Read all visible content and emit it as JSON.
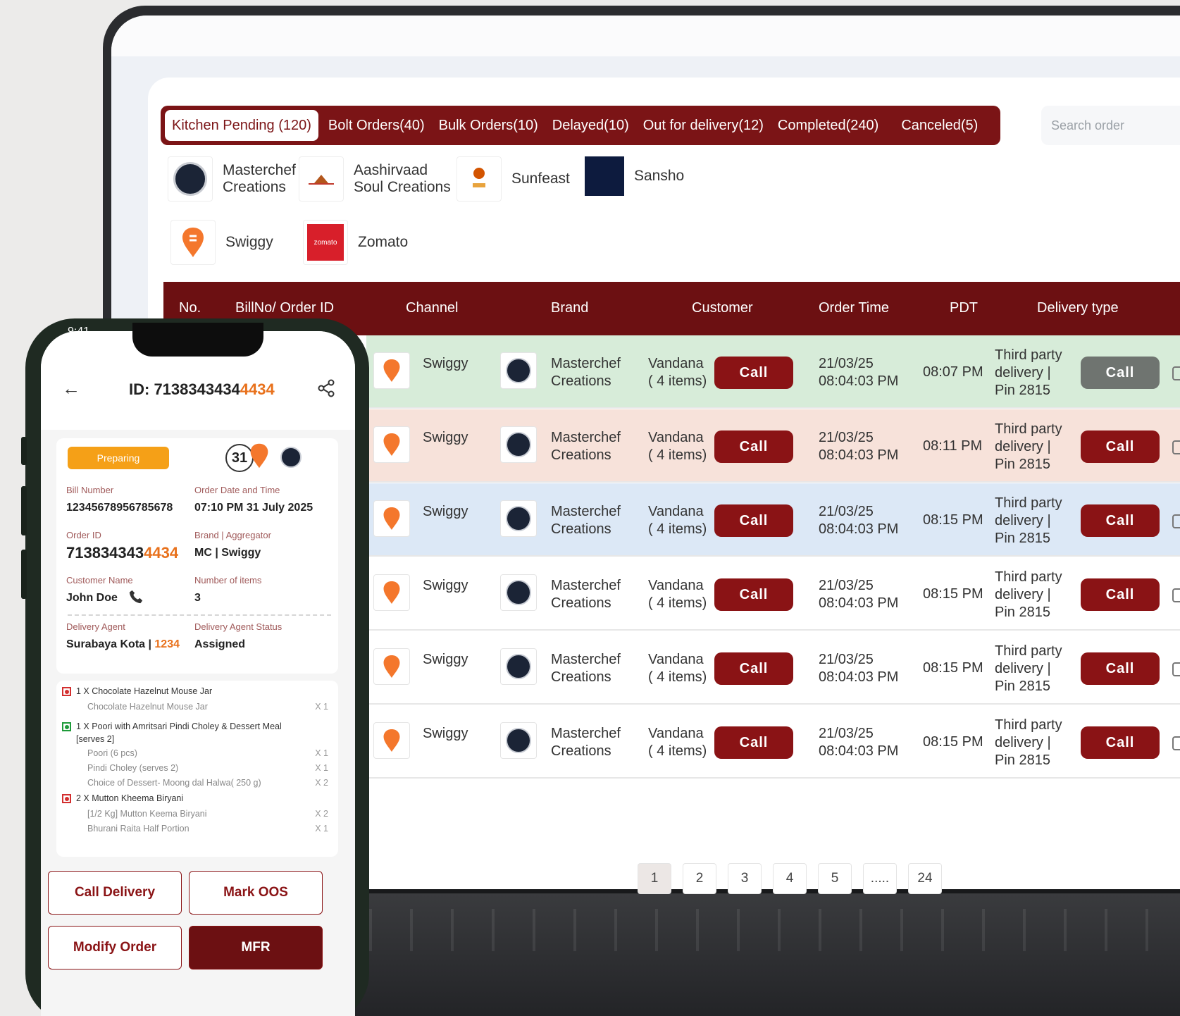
{
  "desktop": {
    "tabs": [
      {
        "label": "Kitchen Pending (120)",
        "active": true
      },
      {
        "label": "Bolt Orders(40)"
      },
      {
        "label": "Bulk Orders(10)"
      },
      {
        "label": "Delayed(10)"
      },
      {
        "label": "Out for delivery(12)"
      },
      {
        "label": "Completed(240)"
      },
      {
        "label": "Canceled(5)"
      }
    ],
    "search_placeholder": "Search order",
    "brand_filters": [
      {
        "line1": "Masterchef",
        "line2": "Creations"
      },
      {
        "line1": "Aashirvaad",
        "line2": "Soul Creations"
      },
      {
        "line1": "Sunfeast",
        "line2": ""
      },
      {
        "line1": "Sansho",
        "line2": ""
      }
    ],
    "channel_filters": [
      "Swiggy",
      "Zomato"
    ],
    "zomato_logo_text": "zomato",
    "columns": [
      "No.",
      "BillNo/ Order ID",
      "Channel",
      "Brand",
      "Customer",
      "Order Time",
      "PDT",
      "Delivery type"
    ],
    "rows": [
      {
        "channel": "Swiggy",
        "brand1": "Masterchef",
        "brand2": "Creations",
        "cust1": "Vandana",
        "cust2": "( 4 items)",
        "call": "Call",
        "date": "21/03/25",
        "time": "08:04:03 PM",
        "pdt": "08:07 PM",
        "del1": "Third party",
        "del2": "delivery |",
        "del3": "Pin 2815",
        "call2": "Call",
        "bg": "#d7ecd9",
        "call2_grey": true
      },
      {
        "channel": "Swiggy",
        "brand1": "Masterchef",
        "brand2": "Creations",
        "cust1": "Vandana",
        "cust2": "( 4 items)",
        "call": "Call",
        "date": "21/03/25",
        "time": "08:04:03 PM",
        "pdt": "08:11 PM",
        "del1": "Third party",
        "del2": "delivery |",
        "del3": "Pin 2815",
        "call2": "Call",
        "bg": "#f7e2da",
        "call2_grey": false
      },
      {
        "channel": "Swiggy",
        "brand1": "Masterchef",
        "brand2": "Creations",
        "cust1": "Vandana",
        "cust2": "( 4 items)",
        "call": "Call",
        "date": "21/03/25",
        "time": "08:04:03 PM",
        "pdt": "08:15 PM",
        "del1": "Third party",
        "del2": "delivery |",
        "del3": "Pin 2815",
        "call2": "Call",
        "bg": "#dce8f6",
        "call2_grey": false
      },
      {
        "channel": "Swiggy",
        "brand1": "Masterchef",
        "brand2": "Creations",
        "cust1": "Vandana",
        "cust2": "( 4 items)",
        "call": "Call",
        "date": "21/03/25",
        "time": "08:04:03 PM",
        "pdt": "08:15 PM",
        "del1": "Third party",
        "del2": "delivery |",
        "del3": "Pin 2815",
        "call2": "Call",
        "bg": "#ffffff",
        "call2_grey": false
      },
      {
        "channel": "Swiggy",
        "brand1": "Masterchef",
        "brand2": "Creations",
        "cust1": "Vandana",
        "cust2": "( 4 items)",
        "call": "Call",
        "date": "21/03/25",
        "time": "08:04:03 PM",
        "pdt": "08:15 PM",
        "del1": "Third party",
        "del2": "delivery |",
        "del3": "Pin 2815",
        "call2": "Call",
        "bg": "#ffffff",
        "call2_grey": false
      },
      {
        "channel": "Swiggy",
        "brand1": "Masterchef",
        "brand2": "Creations",
        "cust1": "Vandana",
        "cust2": "( 4 items)",
        "call": "Call",
        "date": "21/03/25",
        "time": "08:04:03 PM",
        "pdt": "08:15 PM",
        "del1": "Third party",
        "del2": "delivery |",
        "del3": "Pin 2815",
        "call2": "Call",
        "bg": "#ffffff",
        "call2_grey": false
      }
    ],
    "pages": [
      "1",
      "2",
      "3",
      "4",
      "5",
      ".....",
      "24"
    ],
    "active_page": "1"
  },
  "phone": {
    "status_time": "9:41",
    "order_id_prefix": "ID: 7138343434",
    "order_id_highlight": "4434",
    "status_badge": "Preparing",
    "count_badge": "31",
    "bill_number_label": "Bill Number",
    "bill_number": "12345678956785678",
    "order_date_label": "Order Date and Time",
    "order_date": "07:10 PM 31 July 2025",
    "order_id_label": "Order ID",
    "order_id_main": "713834343",
    "order_id_tail": "4434",
    "brand_agg_label": "Brand | Aggregator",
    "brand_agg": "MC | Swiggy",
    "customer_name_label": "Customer Name",
    "customer_name": "John Doe",
    "num_items_label": "Number of items",
    "num_items": "3",
    "agent_label": "Delivery Agent",
    "agent_name": "Surabaya Kota | ",
    "agent_id": "1234",
    "agent_status_label": "Delivery Agent Status",
    "agent_status": "Assigned",
    "items": [
      {
        "text": "1 X Chocolate Hazelnut Mouse Jar",
        "type": "nonveg"
      },
      {
        "text": "Chocolate Hazelnut Mouse Jar",
        "qty": "X 1"
      },
      {
        "text": "1 X Poori with Amritsari Pindi Choley & Dessert Meal",
        "type": "veg"
      },
      {
        "text": "[serves 2]"
      },
      {
        "text": "Poori (6 pcs)",
        "qty": "X 1"
      },
      {
        "text": "Pindi Choley (serves 2)",
        "qty": "X 1"
      },
      {
        "text": "Choice of Dessert- Moong dal Halwa( 250 g)",
        "qty": "X 2"
      },
      {
        "text": "2 X Mutton Kheema Biryani",
        "type": "nonveg"
      },
      {
        "text": "[1/2 Kg] Mutton Keema Biryani",
        "qty": "X 2"
      },
      {
        "text": "Bhurani Raita Half Portion",
        "qty": "X 1"
      }
    ],
    "btn_call_delivery": "Call Delivery",
    "btn_mark_oos": "Mark OOS",
    "btn_modify_order": "Modify Order",
    "btn_mfr": "MFR"
  }
}
